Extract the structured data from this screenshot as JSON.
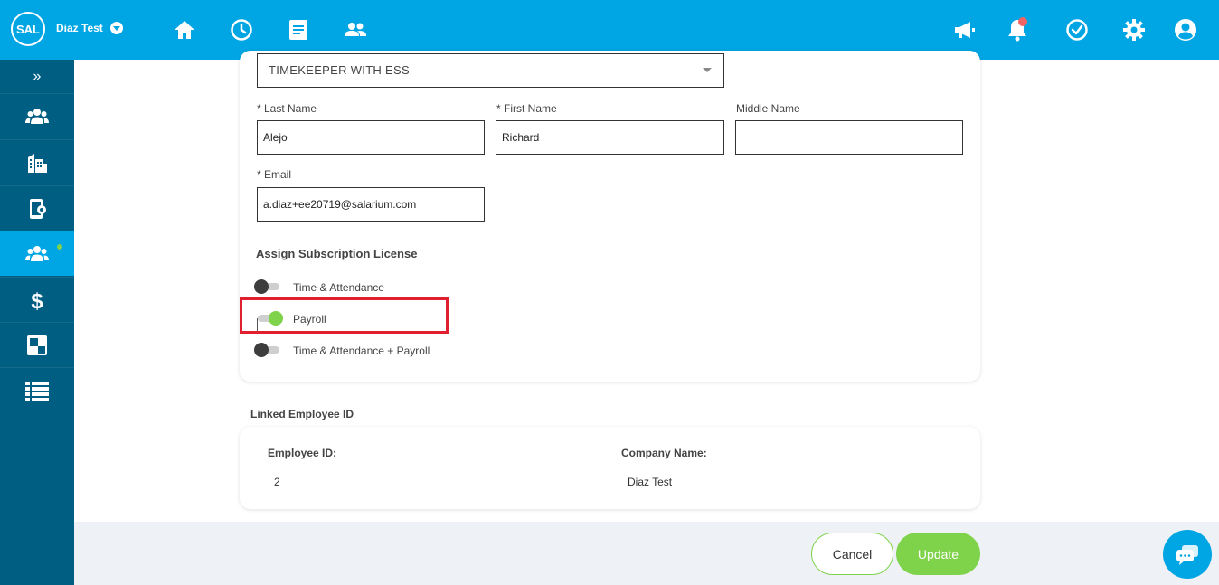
{
  "app": {
    "logo_text": "SAL",
    "company": "Diaz Test"
  },
  "topnav": {
    "left_icons": [
      "home-icon",
      "clock-icon",
      "document-icon",
      "people-icon"
    ],
    "right_icons": [
      "megaphone-icon",
      "bell-icon",
      "check-circle-icon",
      "gear-icon",
      "user-circle-icon"
    ]
  },
  "sidebar": {
    "expand_label": "»",
    "items": [
      "users-icon",
      "building-icon",
      "device-settings-icon",
      "employees-icon",
      "dollar-icon",
      "squares-icon",
      "list-icon"
    ],
    "active_index": 3
  },
  "form": {
    "role_select": "TIMEKEEPER WITH ESS",
    "last_name_label": "* Last Name",
    "last_name_value": "Alejo",
    "first_name_label": "* First Name",
    "first_name_value": "Richard",
    "middle_name_label": "Middle Name",
    "middle_name_value": "",
    "email_label": "* Email",
    "email_value": "a.diaz+ee20719@salarium.com"
  },
  "subscription": {
    "title": "Assign Subscription License",
    "options": [
      {
        "label": "Time & Attendance",
        "on": false
      },
      {
        "label": "Payroll",
        "on": true
      },
      {
        "label": "Time & Attendance + Payroll",
        "on": false
      }
    ]
  },
  "linked": {
    "title": "Linked Employee ID",
    "employee_id_label": "Employee ID:",
    "employee_id_value": "2",
    "company_name_label": "Company Name:",
    "company_name_value": "Diaz Test"
  },
  "actions": {
    "cancel": "Cancel",
    "update": "Update"
  },
  "colors": {
    "primary": "#00a5e3",
    "sidebar": "#005e82",
    "accent_green": "#7fd34a",
    "highlight_red": "#e0202e"
  }
}
